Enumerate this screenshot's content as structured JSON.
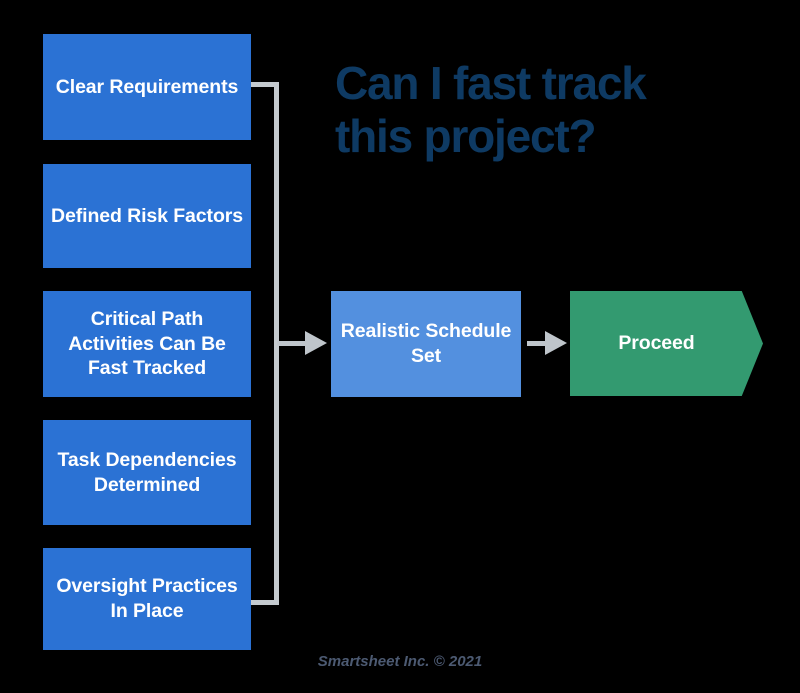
{
  "title": {
    "line1": "Can I fast track",
    "line2": "this project?",
    "color": "#0E3A63"
  },
  "colors": {
    "background": "#000000",
    "criteria_box": "#2B72D4",
    "decision_box": "#5390DF",
    "proceed_shape": "#339A70",
    "connector": "#C4CACF",
    "arrow": "#BFC5CB",
    "box_text": "#FFFFFF",
    "footer_text": "#4C5A72"
  },
  "criteria": [
    {
      "id": "clear-requirements",
      "line1": "Clear",
      "line2": "Requirements",
      "line3": ""
    },
    {
      "id": "defined-risk-factors",
      "line1": "Defined Risk",
      "line2": "Factors",
      "line3": ""
    },
    {
      "id": "critical-path",
      "line1": "Critical Path",
      "line2": "Activities Can",
      "line3": "Be Fast Tracked"
    },
    {
      "id": "task-dependencies",
      "line1": "Task",
      "line2": "Dependencies",
      "line3": "Determined"
    },
    {
      "id": "oversight-practices",
      "line1": "Oversight",
      "line2": "Practices",
      "line3": "In Place"
    }
  ],
  "decision": {
    "id": "realistic-schedule-set",
    "line1": "Realistic",
    "line2": "Schedule Set"
  },
  "outcome": {
    "id": "proceed",
    "label": "Proceed",
    "shape": "pentagon-arrow"
  },
  "footer": {
    "text": "Smartsheet Inc. © 2021"
  }
}
